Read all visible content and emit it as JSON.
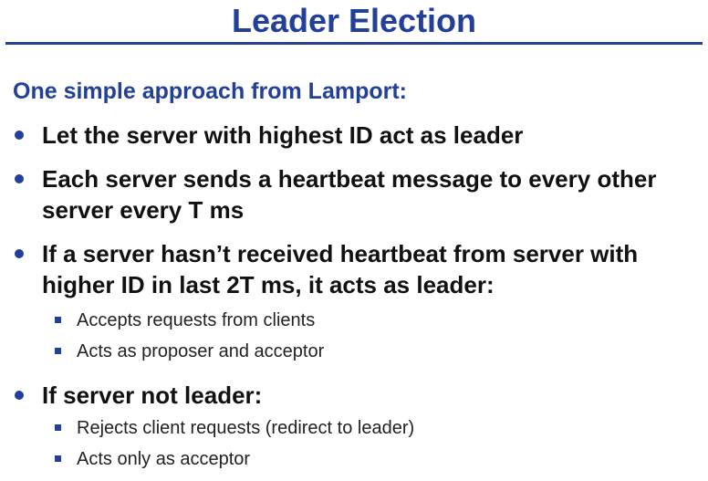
{
  "slide": {
    "title": "Leader Election",
    "subtitle": "One simple approach from Lamport:",
    "bullets": [
      {
        "text": "Let the server with highest ID act as leader",
        "subitems": []
      },
      {
        "text": "Each server sends a heartbeat message to every other server every T ms",
        "subitems": []
      },
      {
        "text": "If a server hasn’t received heartbeat from server with higher ID in last 2T ms, it acts as leader:",
        "subitems": [
          "Accepts requests from clients",
          "Acts as proposer and acceptor"
        ]
      },
      {
        "text": "If server not leader:",
        "subitems": [
          "Rejects client requests (redirect to leader)",
          "Acts only as acceptor"
        ]
      }
    ]
  },
  "colors": {
    "accent": "#22409a",
    "text": "#111111"
  },
  "icons": {
    "bullet": "round-bullet-icon",
    "subbullet": "square-bullet-icon"
  }
}
